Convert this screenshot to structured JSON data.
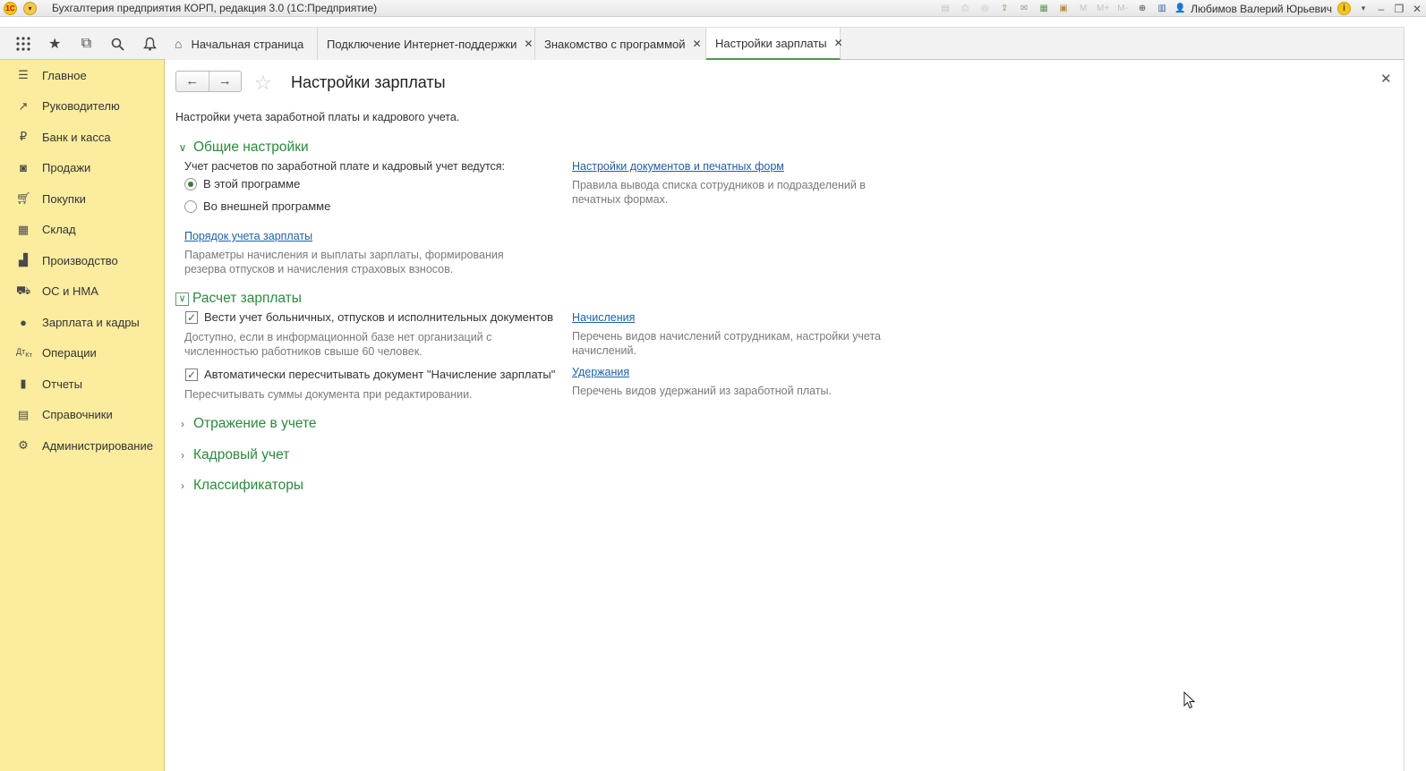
{
  "window": {
    "app_title": "Бухгалтерия предприятия КОРП, редакция 3.0  (1С:Предприятие)",
    "user_name": "Любимов Валерий Юрьевич"
  },
  "toolbar_icons": [
    "save-icon",
    "print-icon",
    "preview-icon",
    "upload-icon",
    "mail-icon",
    "calculator-icon",
    "calendar-icon",
    "memory-m-icon",
    "memory-plus-icon",
    "memory-minus-icon",
    "zoom-icon",
    "panels-icon"
  ],
  "tabs": [
    {
      "label": "Начальная страница",
      "closable": false,
      "home": true
    },
    {
      "label": "Подключение Интернет-поддержки",
      "closable": true
    },
    {
      "label": "Знакомство с программой",
      "closable": true
    },
    {
      "label": "Настройки зарплаты",
      "closable": true,
      "active": true
    }
  ],
  "sidebar": {
    "items": [
      {
        "label": "Главное",
        "icon": "menu-icon"
      },
      {
        "label": "Руководителю",
        "icon": "trend-icon"
      },
      {
        "label": "Банк и касса",
        "icon": "ruble-icon"
      },
      {
        "label": "Продажи",
        "icon": "bag-icon"
      },
      {
        "label": "Покупки",
        "icon": "cart-icon"
      },
      {
        "label": "Склад",
        "icon": "warehouse-icon"
      },
      {
        "label": "Производство",
        "icon": "factory-icon"
      },
      {
        "label": "ОС и НМА",
        "icon": "truck-icon"
      },
      {
        "label": "Зарплата и кадры",
        "icon": "person-icon"
      },
      {
        "label": "Операции",
        "icon": "dt-kt-icon"
      },
      {
        "label": "Отчеты",
        "icon": "bar-chart-icon"
      },
      {
        "label": "Справочники",
        "icon": "books-icon"
      },
      {
        "label": "Администрирование",
        "icon": "gear-icon"
      }
    ]
  },
  "form": {
    "title": "Настройки зарплаты",
    "description": "Настройки учета заработной платы и кадрового учета.",
    "general": {
      "header": "Общие настройки",
      "accounting_label": "Учет расчетов по заработной плате и кадровый учет ведутся:",
      "radio_this": "В этой программе",
      "radio_external": "Во внешней программе",
      "selected": "В этой программе",
      "order_link": "Порядок учета зарплаты",
      "order_hint_1": "Параметры начисления и выплаты зарплаты, формирования",
      "order_hint_2": "резерва отпусков и начисления страховых взносов.",
      "docs_link": "Настройки документов и печатных форм",
      "docs_hint_1": "Правила вывода списка сотрудников и подразделений в",
      "docs_hint_2": "печатных формах."
    },
    "payroll": {
      "header": "Расчет зарплаты",
      "check_sick": "Вести учет больничных, отпусков и исполнительных документов",
      "check_sick_hint_1": "Доступно, если в информационной базе нет организаций с",
      "check_sick_hint_2": "численностью работников свыше 60 человек.",
      "check_recalc": "Автоматически пересчитывать документ \"Начисление зарплаты\"",
      "check_recalc_hint": "Пересчитывать суммы документа при редактировании.",
      "accruals_link": "Начисления",
      "accruals_hint_1": "Перечень видов начислений сотрудникам, настройки учета",
      "accruals_hint_2": "начислений.",
      "deductions_link": "Удержания",
      "deductions_hint": "Перечень видов удержаний из заработной платы."
    },
    "collapsed_groups": [
      "Отражение в учете",
      "Кадровый учет",
      "Классификаторы"
    ]
  },
  "colors": {
    "sidebar_bg": "#fbec9e",
    "group_header": "#2a8a3c",
    "link": "#1f5fa8",
    "active_tab_underline": "#4c9a4c"
  }
}
